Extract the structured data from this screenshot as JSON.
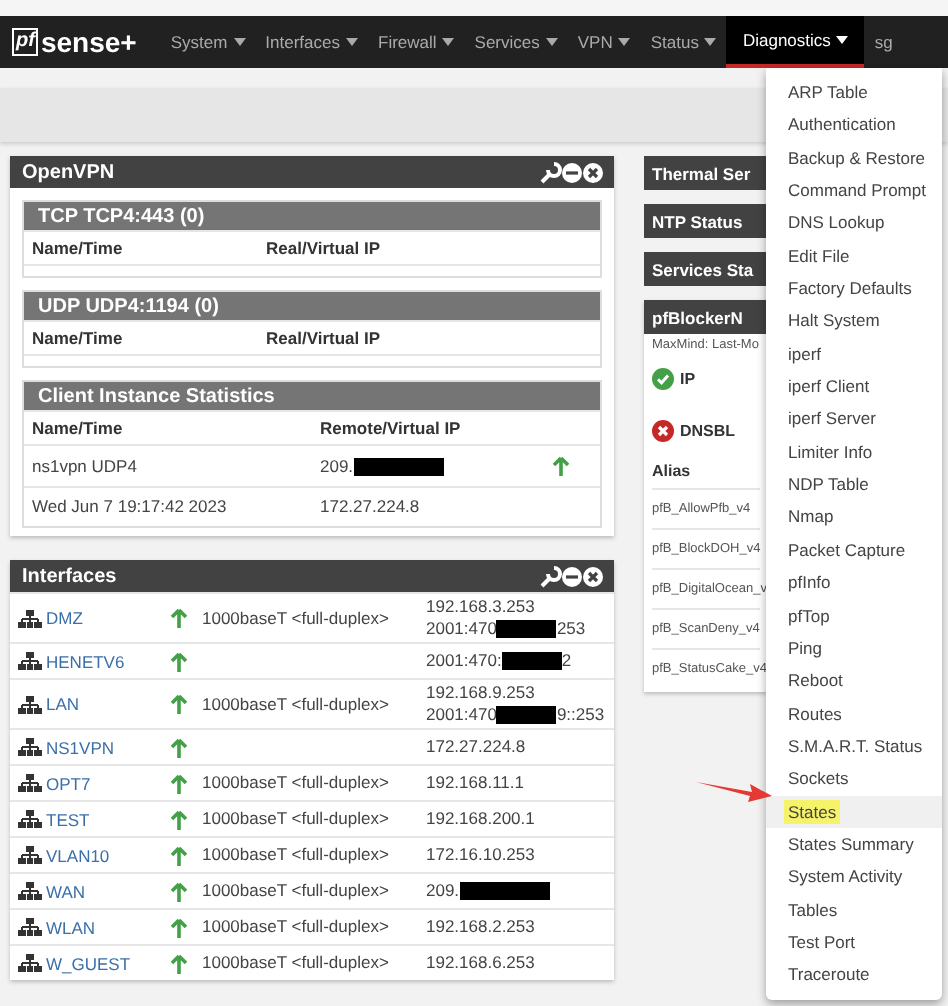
{
  "navbar": {
    "logo": {
      "mark": "pf",
      "text": "sense+"
    },
    "items": [
      {
        "label": "System",
        "selected": false,
        "caret": true
      },
      {
        "label": "Interfaces",
        "selected": false,
        "caret": true
      },
      {
        "label": "Firewall",
        "selected": false,
        "caret": true
      },
      {
        "label": "Services",
        "selected": false,
        "caret": true
      },
      {
        "label": "VPN",
        "selected": false,
        "caret": true
      },
      {
        "label": "Status",
        "selected": false,
        "caret": true
      },
      {
        "label": "Diagnostics",
        "selected": true,
        "caret": true
      },
      {
        "label": "sg",
        "selected": false,
        "caret": false
      }
    ]
  },
  "openvpn": {
    "title": "OpenVPN",
    "servers": [
      {
        "title": "TCP TCP4:443 (0)",
        "columns": [
          "Name/Time",
          "Real/Virtual IP"
        ]
      },
      {
        "title": "UDP UDP4:1194 (0)",
        "columns": [
          "Name/Time",
          "Real/Virtual IP"
        ]
      }
    ],
    "clients": {
      "title": "Client Instance Statistics",
      "columns": [
        "Name/Time",
        "Remote/Virtual IP"
      ],
      "rows": [
        {
          "name": "ns1vpn UDP4",
          "time": "Wed Jun 7 19:17:42 2023",
          "remote": {
            "text": "209.",
            "redacted": true
          },
          "virtual": "172.27.224.8",
          "up": true
        }
      ]
    }
  },
  "interfaces": {
    "title": "Interfaces",
    "rows": [
      {
        "name": "DMZ",
        "up": true,
        "media": "1000baseT <full-duplex>",
        "ips": [
          {
            "text": "192.168.3.253"
          },
          {
            "text": "2001:470",
            "redacted": true,
            "tail": "253"
          }
        ]
      },
      {
        "name": "HENETV6",
        "up": true,
        "ips": [
          {
            "text": "2001:470:",
            "redacted": true,
            "tail": "2"
          }
        ]
      },
      {
        "name": "LAN",
        "up": true,
        "media": "1000baseT <full-duplex>",
        "ips": [
          {
            "text": "192.168.9.253"
          },
          {
            "text": "2001:470",
            "redacted": true,
            "tail": "9::253"
          }
        ]
      },
      {
        "name": "NS1VPN",
        "up": true,
        "ips": [
          {
            "text": "172.27.224.8"
          }
        ]
      },
      {
        "name": "OPT7",
        "up": true,
        "media": "1000baseT <full-duplex>",
        "ips": [
          {
            "text": "192.168.11.1"
          }
        ]
      },
      {
        "name": "TEST",
        "up": true,
        "media": "1000baseT <full-duplex>",
        "ips": [
          {
            "text": "192.168.200.1"
          }
        ]
      },
      {
        "name": "VLAN10",
        "up": true,
        "media": "1000baseT <full-duplex>",
        "ips": [
          {
            "text": "172.16.10.253"
          }
        ]
      },
      {
        "name": "WAN",
        "up": true,
        "media": "1000baseT <full-duplex>",
        "ips": [
          {
            "text": "209.",
            "redacted": true
          }
        ]
      },
      {
        "name": "WLAN",
        "up": true,
        "media": "1000baseT <full-duplex>",
        "ips": [
          {
            "text": "192.168.2.253"
          }
        ]
      },
      {
        "name": "W_GUEST",
        "up": true,
        "media": "1000baseT <full-duplex>",
        "ips": [
          {
            "text": "192.168.6.253"
          }
        ]
      }
    ]
  },
  "right_panels": [
    {
      "title": "Thermal Ser"
    },
    {
      "title": "NTP Status"
    },
    {
      "title": "Services Sta"
    }
  ],
  "pfblocker": {
    "title": "pfBlockerN",
    "note": "MaxMind: Last-Mo",
    "rows": [
      {
        "label": "IP",
        "ok": true
      },
      {
        "label": "DNSBL",
        "ok": false
      }
    ],
    "alias_header": "Alias",
    "aliases": [
      "pfB_AllowPfb_v4",
      "pfB_BlockDOH_v4",
      "pfB_DigitalOcean_v",
      "pfB_ScanDeny_v4",
      "pfB_StatusCake_v4"
    ]
  },
  "diagnostics_menu": [
    {
      "label": "ARP Table",
      "selected": false
    },
    {
      "label": "Authentication",
      "selected": false
    },
    {
      "label": "Backup & Restore",
      "selected": false
    },
    {
      "label": "Command Prompt",
      "selected": false
    },
    {
      "label": "DNS Lookup",
      "selected": false
    },
    {
      "label": "Edit File",
      "selected": false
    },
    {
      "label": "Factory Defaults",
      "selected": false
    },
    {
      "label": "Halt System",
      "selected": false
    },
    {
      "label": "iperf",
      "selected": false
    },
    {
      "label": "iperf Client",
      "selected": false
    },
    {
      "label": "iperf Server",
      "selected": false
    },
    {
      "label": "Limiter Info",
      "selected": false
    },
    {
      "label": "NDP Table",
      "selected": false
    },
    {
      "label": "Nmap",
      "selected": false
    },
    {
      "label": "Packet Capture",
      "selected": false
    },
    {
      "label": "pfInfo",
      "selected": false
    },
    {
      "label": "pfTop",
      "selected": false
    },
    {
      "label": "Ping",
      "selected": false
    },
    {
      "label": "Reboot",
      "selected": false
    },
    {
      "label": "Routes",
      "selected": false
    },
    {
      "label": "S.M.A.R.T. Status",
      "selected": false
    },
    {
      "label": "Sockets",
      "selected": false
    },
    {
      "label": "States",
      "selected": true
    },
    {
      "label": "States Summary",
      "selected": false
    },
    {
      "label": "System Activity",
      "selected": false
    },
    {
      "label": "Tables",
      "selected": false
    },
    {
      "label": "Test Port",
      "selected": false
    },
    {
      "label": "Traceroute",
      "selected": false
    }
  ]
}
